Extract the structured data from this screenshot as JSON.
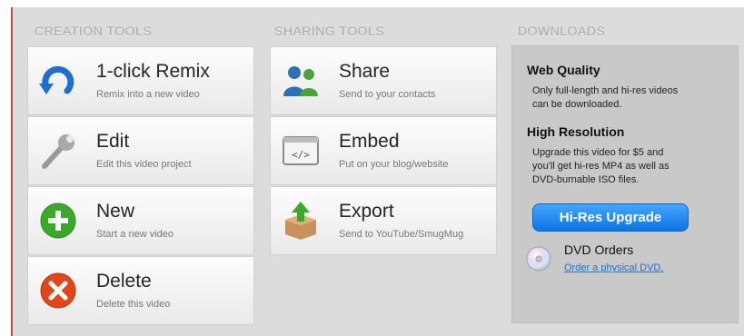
{
  "creation_tools": {
    "title": "CREATION TOOLS",
    "items": [
      {
        "title": "1-click Remix",
        "subtitle": "Remix into a new video",
        "icon": "remix-arrow-icon"
      },
      {
        "title": "Edit",
        "subtitle": "Edit this video project",
        "icon": "wrench-icon"
      },
      {
        "title": "New",
        "subtitle": "Start a new video",
        "icon": "plus-circle-icon"
      },
      {
        "title": "Delete",
        "subtitle": "Delete this video",
        "icon": "x-circle-icon"
      }
    ]
  },
  "sharing_tools": {
    "title": "SHARING TOOLS",
    "items": [
      {
        "title": "Share",
        "subtitle": "Send to your contacts",
        "icon": "people-icon"
      },
      {
        "title": "Embed",
        "subtitle": "Put on your blog/website",
        "icon": "code-embed-icon"
      },
      {
        "title": "Export",
        "subtitle": "Send to YouTube/SmugMug",
        "icon": "box-upload-icon"
      }
    ]
  },
  "downloads": {
    "title": "DOWNLOADS",
    "web_quality": {
      "heading": "Web Quality",
      "line1": "Only full-length and hi-res videos",
      "line2": "can be downloaded."
    },
    "high_resolution": {
      "heading": "High Resolution",
      "line1": "Upgrade this video for $5 and",
      "line2": "you'll get hi-res MP4 as well as",
      "line3": "DVD-burnable ISO files."
    },
    "button_label": "Hi-Res Upgrade",
    "dvd": {
      "title": "DVD Orders",
      "link": "Order a physical DVD."
    }
  },
  "colors": {
    "accent_blue": "#1a82f0",
    "plus_green": "#3aa829",
    "delete_orange": "#e0461a",
    "frame_border": "#c0504d"
  }
}
